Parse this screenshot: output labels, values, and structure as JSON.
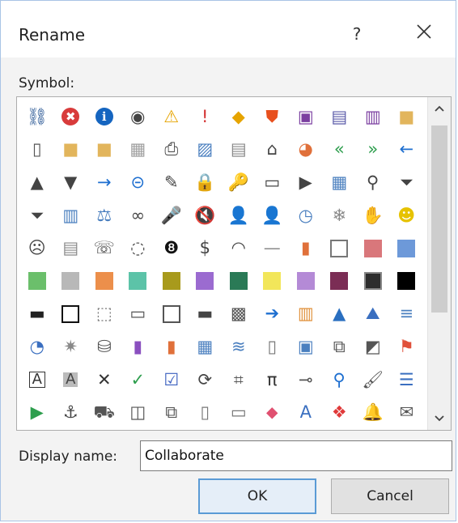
{
  "dialog": {
    "title": "Rename",
    "help_label": "?",
    "close_icon": "close-icon"
  },
  "symbol_label": "Symbol:",
  "symbols": [
    [
      {
        "g": "⛓",
        "c": "#1f4f8f"
      },
      {
        "g": "✖",
        "c": "#d83b3b",
        "bg": "#d83b3b",
        "w": true
      },
      {
        "g": "ℹ",
        "c": "#1565c0",
        "bg": "#1565c0",
        "w": true
      },
      {
        "g": "◉",
        "c": "#444"
      },
      {
        "g": "⚠",
        "c": "#e6a400"
      },
      {
        "g": "!",
        "c": "#d32f2f"
      },
      {
        "g": "◆",
        "c": "#e6a400"
      },
      {
        "g": "⛊",
        "c": "#e8501e"
      },
      {
        "g": "▣",
        "c": "#7b3fa0"
      },
      {
        "g": "▤",
        "c": "#5a5aa8"
      },
      {
        "g": "▥",
        "c": "#7b3fa0"
      },
      {
        "g": "■",
        "c": "#e2b55c"
      }
    ],
    [
      {
        "g": "▯",
        "c": "#555"
      },
      {
        "g": "■",
        "c": "#e2b55c"
      },
      {
        "g": "■",
        "c": "#e2b55c"
      },
      {
        "g": "▦",
        "c": "#9e9e9e"
      },
      {
        "g": "⎙",
        "c": "#444"
      },
      {
        "g": "▨",
        "c": "#4a7fbf"
      },
      {
        "g": "▤",
        "c": "#888"
      },
      {
        "g": "⌂",
        "c": "#444"
      },
      {
        "g": "◕",
        "c": "#e0703a"
      },
      {
        "g": "«",
        "c": "#2e9e4e"
      },
      {
        "g": "»",
        "c": "#2e9e4e"
      },
      {
        "g": "←",
        "c": "#1e6fd0"
      }
    ],
    [
      {
        "g": "▲",
        "c": "#444"
      },
      {
        "g": "▼",
        "c": "#444"
      },
      {
        "g": "→",
        "c": "#1e6fd0"
      },
      {
        "g": "⊝",
        "c": "#1e6fd0"
      },
      {
        "g": "✎",
        "c": "#444"
      },
      {
        "g": "🔒",
        "c": "#e6a400"
      },
      {
        "g": "🔑",
        "c": "#444"
      },
      {
        "g": "▭",
        "c": "#444"
      },
      {
        "g": "▶",
        "c": "#444"
      },
      {
        "g": "▦",
        "c": "#4a7fbf"
      },
      {
        "g": "⚲",
        "c": "#444"
      },
      {
        "g": "⏷",
        "c": "#444"
      }
    ],
    [
      {
        "g": "⏷",
        "c": "#444"
      },
      {
        "g": "▥",
        "c": "#4a7fbf"
      },
      {
        "g": "⚖",
        "c": "#4a7fbf"
      },
      {
        "g": "∞",
        "c": "#444"
      },
      {
        "g": "🎤",
        "c": "#4a7fbf"
      },
      {
        "g": "🔇",
        "c": "#444"
      },
      {
        "g": "👤",
        "c": "#444"
      },
      {
        "g": "👤",
        "c": "#444"
      },
      {
        "g": "◷",
        "c": "#4a7fbf"
      },
      {
        "g": "❄",
        "c": "#888"
      },
      {
        "g": "✋",
        "c": "#888"
      },
      {
        "g": "☻",
        "c": "#e6c200"
      }
    ],
    [
      {
        "g": "☹",
        "c": "#444"
      },
      {
        "g": "▤",
        "c": "#888"
      },
      {
        "g": "☏",
        "c": "#444"
      },
      {
        "g": "◌",
        "c": "#444"
      },
      {
        "g": "❽",
        "c": "#111"
      },
      {
        "g": "$",
        "c": "#444"
      },
      {
        "g": "◠",
        "c": "#444"
      },
      {
        "g": "—",
        "c": "#888"
      },
      {
        "g": "▮",
        "c": "#e0703a"
      },
      {
        "sw": "#ffffff",
        "b": "#777"
      },
      {
        "sw": "#d9777b"
      },
      {
        "sw": "#6d99d9"
      }
    ],
    [
      {
        "sw": "#6bbf6b"
      },
      {
        "sw": "#b8b8b8"
      },
      {
        "sw": "#ec8f4b"
      },
      {
        "sw": "#5cc3a8"
      },
      {
        "sw": "#a89a1c"
      },
      {
        "sw": "#9b6bd0"
      },
      {
        "sw": "#2a7a56"
      },
      {
        "sw": "#f2e65a"
      },
      {
        "sw": "#b48ad6"
      },
      {
        "sw": "#7b2d55"
      },
      {
        "sw": "#2d2d2d",
        "b": "#888"
      },
      {
        "sw": "#000000"
      }
    ],
    [
      {
        "g": "▬",
        "c": "#222"
      },
      {
        "sw": "#ffffff",
        "b": "#111"
      },
      {
        "g": "⬚",
        "c": "#777"
      },
      {
        "g": "▭",
        "c": "#555"
      },
      {
        "sw": "#ffffff",
        "b": "#555"
      },
      {
        "g": "▬",
        "c": "#444"
      },
      {
        "g": "▩",
        "c": "#555"
      },
      {
        "g": "➔",
        "c": "#1e6fd0"
      },
      {
        "g": "▥",
        "c": "#e0903a"
      },
      {
        "g": "▲",
        "c": "#2a6fc0"
      },
      {
        "g": "⛰",
        "c": "#3a6fc0"
      },
      {
        "g": "≡",
        "c": "#4a7fbf"
      }
    ],
    [
      {
        "g": "◔",
        "c": "#3a6fc0"
      },
      {
        "g": "✷",
        "c": "#888"
      },
      {
        "g": "⛁",
        "c": "#555"
      },
      {
        "g": "▮",
        "c": "#8a4fbf"
      },
      {
        "g": "▮",
        "c": "#e0703a"
      },
      {
        "g": "▦",
        "c": "#4a7fbf"
      },
      {
        "g": "≋",
        "c": "#4a7fbf"
      },
      {
        "g": "▯",
        "c": "#777"
      },
      {
        "g": "▣",
        "c": "#4a7fbf"
      },
      {
        "g": "⧉",
        "c": "#555"
      },
      {
        "g": "◩",
        "c": "#555"
      },
      {
        "g": "⚑",
        "c": "#e0503a"
      }
    ],
    [
      {
        "g": "A",
        "c": "#333",
        "box": true
      },
      {
        "g": "A",
        "c": "#444",
        "grey": true
      },
      {
        "g": "✕",
        "c": "#333"
      },
      {
        "g": "✓",
        "c": "#2e9e4e"
      },
      {
        "g": "☑",
        "c": "#3a5fbf"
      },
      {
        "g": "⟳",
        "c": "#444"
      },
      {
        "g": "⌗",
        "c": "#555"
      },
      {
        "g": "π",
        "c": "#333"
      },
      {
        "g": "⊸",
        "c": "#555"
      },
      {
        "g": "⚲",
        "c": "#1e6fd0"
      },
      {
        "g": "🖌",
        "c": "#555"
      },
      {
        "g": "☰",
        "c": "#3a6fc0"
      }
    ],
    [
      {
        "g": "▶",
        "c": "#2e9e4e"
      },
      {
        "g": "⚓",
        "c": "#444"
      },
      {
        "g": "⛟",
        "c": "#555"
      },
      {
        "g": "◫",
        "c": "#555"
      },
      {
        "g": "⧉",
        "c": "#555"
      },
      {
        "g": "▯",
        "c": "#777"
      },
      {
        "g": "▭",
        "c": "#777"
      },
      {
        "g": "⬥",
        "c": "#e05070"
      },
      {
        "g": "A",
        "c": "#3a6fc0"
      },
      {
        "g": "❖",
        "c": "#e03a3a"
      },
      {
        "g": "🔔",
        "c": "#e6b400"
      },
      {
        "g": "✉",
        "c": "#555"
      }
    ]
  ],
  "display_name_label": "Display name:",
  "display_name_value": "Collaborate",
  "buttons": {
    "ok": "OK",
    "cancel": "Cancel"
  },
  "scroll": {
    "up_icon": "chevron-up-icon",
    "down_icon": "chevron-down-icon"
  }
}
